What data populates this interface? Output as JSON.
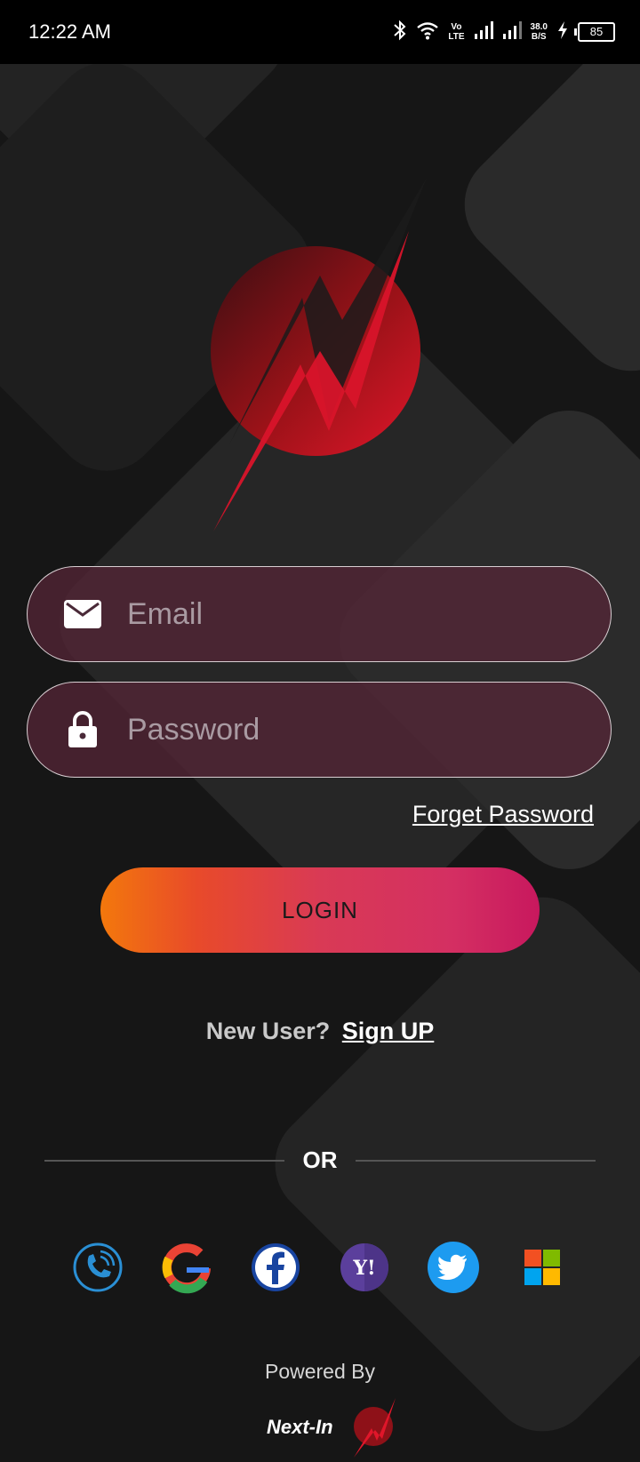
{
  "status_bar": {
    "time": "12:22 AM",
    "network_label_top": "Vo",
    "network_label_bottom": "LTE",
    "speed_top": "38.0",
    "speed_bottom": "B/S",
    "battery": "85",
    "icons": [
      "bluetooth-icon",
      "wifi-icon",
      "signal-icon",
      "signal-icon",
      "charging-icon",
      "battery-icon"
    ]
  },
  "form": {
    "email_placeholder": "Email",
    "password_placeholder": "Password",
    "forget_password": "Forget Password",
    "login_label": "LOGIN"
  },
  "signup": {
    "question": "New User?",
    "link": "Sign UP"
  },
  "divider": {
    "text": "OR"
  },
  "social": {
    "providers": [
      "phone-icon",
      "google-icon",
      "facebook-icon",
      "yahoo-icon",
      "twitter-icon",
      "microsoft-icon"
    ]
  },
  "footer": {
    "powered_by": "Powered By",
    "brand": "Next-In"
  },
  "colors": {
    "background": "#161616",
    "accent_red": "#d4142a",
    "field_bg": "#4a2a38",
    "login_gradient_start": "#f3780c",
    "login_gradient_end": "#c8185e"
  }
}
